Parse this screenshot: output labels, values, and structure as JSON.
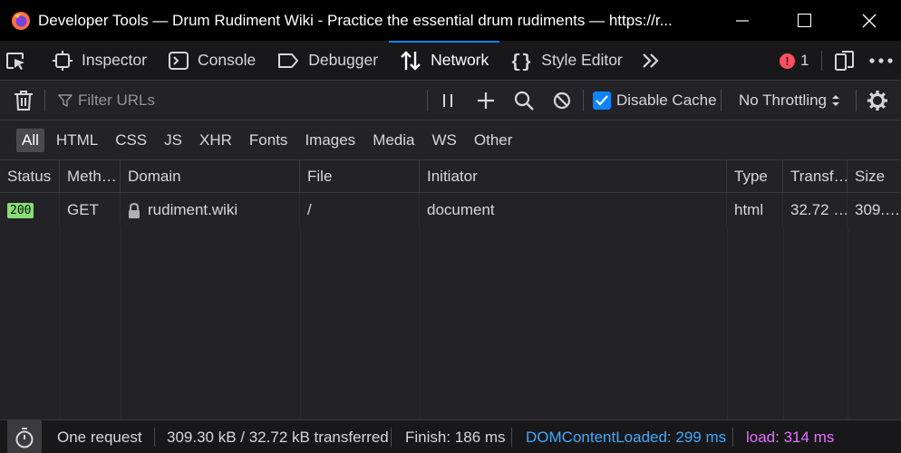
{
  "window": {
    "title": "Developer Tools — Drum Rudiment Wiki - Practice the essential drum rudiments — https://r..."
  },
  "tabs": [
    {
      "label": "Inspector",
      "icon": "inspector-icon"
    },
    {
      "label": "Console",
      "icon": "console-icon"
    },
    {
      "label": "Debugger",
      "icon": "debugger-icon"
    },
    {
      "label": "Network",
      "icon": "network-icon",
      "selected": true
    },
    {
      "label": "Style Editor",
      "icon": "style-editor-icon"
    }
  ],
  "error_count": "1",
  "toolbar": {
    "filter_placeholder": "Filter URLs",
    "disable_cache_label": "Disable Cache",
    "disable_cache_checked": true,
    "throttling_label": "No Throttling"
  },
  "type_filters": [
    "All",
    "HTML",
    "CSS",
    "JS",
    "XHR",
    "Fonts",
    "Images",
    "Media",
    "WS",
    "Other"
  ],
  "active_type_filter": "All",
  "columns": [
    "Status",
    "Meth…",
    "Domain",
    "File",
    "Initiator",
    "Type",
    "Transf…",
    "Size"
  ],
  "requests": [
    {
      "status": "200",
      "method": "GET",
      "domain": "rudiment.wiki",
      "file": "/",
      "initiator": "document",
      "type": "html",
      "transferred": "32.72 …",
      "size": "309.…"
    }
  ],
  "summary": {
    "requests": "One request",
    "sizes": "309.30 kB / 32.72 kB transferred",
    "finish": "Finish: 186 ms",
    "dom_content_loaded": "DOMContentLoaded: 299 ms",
    "load": "load: 314 ms"
  },
  "colors": {
    "accent": "#0a84ff",
    "status_ok": "#86de74",
    "dom_loaded": "#3fa9ff",
    "load": "#e56eff",
    "error": "#ff4f5e"
  }
}
